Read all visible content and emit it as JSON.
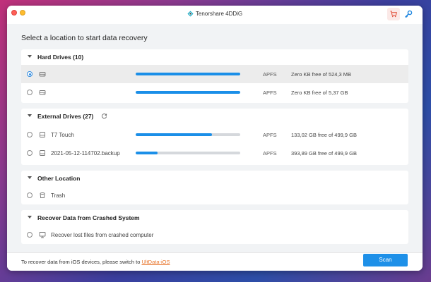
{
  "app": {
    "title": "Tenorshare 4DDiG",
    "logo_icon": "tenorshare-logo-icon",
    "cart_icon": "cart-icon",
    "key_icon": "key-icon"
  },
  "page": {
    "heading": "Select a location to start data recovery"
  },
  "sections": {
    "hard_drives": {
      "title": "Hard Drives (10)",
      "items": [
        {
          "name": "",
          "icon": "hard-drive-icon",
          "fs": "APFS",
          "free": "Zero KB free of 524,3 MB",
          "used_fraction": 1.0,
          "selected": true
        },
        {
          "name": "",
          "icon": "hard-drive-icon",
          "fs": "APFS",
          "free": "Zero KB free of 5,37 GB",
          "used_fraction": 1.0,
          "selected": false
        }
      ]
    },
    "external_drives": {
      "title": "External Drives (27)",
      "refresh_icon": "refresh-icon",
      "items": [
        {
          "name": "T7 Touch",
          "icon": "external-drive-icon",
          "fs": "APFS",
          "free": "133,02 GB free of 499,9 GB",
          "used_fraction": 0.73,
          "selected": false
        },
        {
          "name": "2021-05-12-114702.backup",
          "icon": "external-drive-icon",
          "fs": "APFS",
          "free": "393,89 GB free of 499,9 GB",
          "used_fraction": 0.21,
          "selected": false
        }
      ]
    },
    "other_location": {
      "title": "Other Location",
      "items": [
        {
          "name": "Trash",
          "icon": "trash-icon",
          "selected": false
        }
      ]
    },
    "crashed_system": {
      "title": "Recover Data from Crashed System",
      "items": [
        {
          "name": "Recover lost files from crashed computer",
          "icon": "computer-icon",
          "selected": false
        }
      ]
    }
  },
  "footer": {
    "text": "To recover data from iOS devices, please switch to ",
    "link": "UltData-iOS",
    "scan_label": "Scan"
  },
  "colors": {
    "accent": "#1e90e8",
    "link": "#e8762d",
    "close": "#fe5f57",
    "minimize": "#febc2e"
  }
}
